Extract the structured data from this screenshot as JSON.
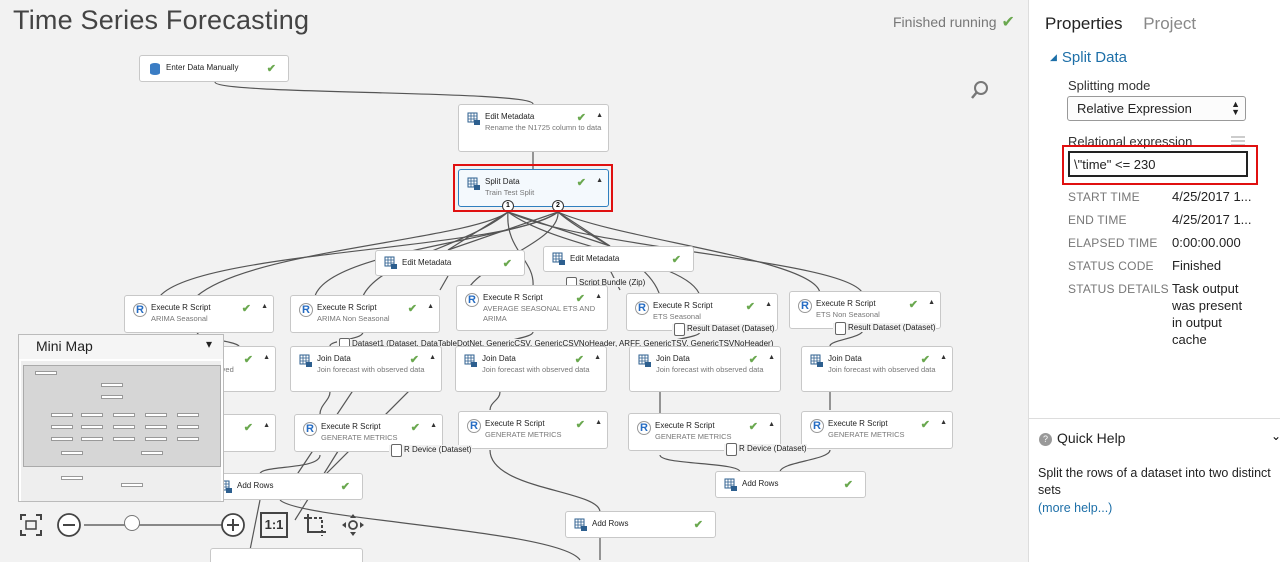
{
  "experiment": {
    "title": "Time Series Forecasting",
    "status": "Finished running",
    "status_icon": "check-icon"
  },
  "nodes": {
    "enter_data": {
      "title": "Enter Data Manually",
      "subtitle": ""
    },
    "edit_meta_1": {
      "title": "Edit Metadata",
      "subtitle": "Rename the N1725 column to data"
    },
    "split": {
      "title": "Split Data",
      "subtitle": "Train Test Split",
      "port1": "1",
      "port2": "2"
    },
    "edit_meta_2": {
      "title": "Edit Metadata",
      "subtitle": ""
    },
    "edit_meta_3": {
      "title": "Edit Metadata",
      "subtitle": ""
    },
    "r_arima": {
      "title": "Execute R Script",
      "subtitle": "ARIMA Seasonal"
    },
    "r_arima_ns": {
      "title": "Execute R Script",
      "subtitle": "ARIMA Non Seasonal"
    },
    "r_avg": {
      "title": "Execute R Script",
      "subtitle": "AVERAGE SEASONAL ETS AND ARIMA"
    },
    "r_ets": {
      "title": "Execute R Script",
      "subtitle": "ETS Seasonal"
    },
    "r_ets_ns": {
      "title": "Execute R Script",
      "subtitle": "ETS Non Seasonal"
    },
    "join_1": {
      "title": "Join Data",
      "subtitle": "Join forecast with observed data"
    },
    "join_2": {
      "title": "Join Data",
      "subtitle": "Join forecast with observed data"
    },
    "join_3": {
      "title": "Join Data",
      "subtitle": "Join forecast with observed data"
    },
    "join_4": {
      "title": "Join Data",
      "subtitle": "Join forecast with observed data"
    },
    "join_0_frag": {
      "title": "",
      "subtitle": "erved"
    },
    "m_1": {
      "title": "Execute R Script",
      "subtitle": "GENERATE METRICS"
    },
    "m_2": {
      "title": "Execute R Script",
      "subtitle": "GENERATE METRICS"
    },
    "m_3": {
      "title": "Execute R Script",
      "subtitle": "GENERATE METRICS"
    },
    "m_4": {
      "title": "Execute R Script",
      "subtitle": "GENERATE METRICS"
    },
    "add_1": {
      "title": "Add Rows"
    },
    "add_2": {
      "title": "Add Rows"
    },
    "add_3": {
      "title": "Add Rows"
    }
  },
  "port_labels": {
    "script_bundle": "Script Bundle (Zip)",
    "result_1": "Result Dataset (Dataset)",
    "result_2": "Result Dataset (Dataset)",
    "dataset1": "Dataset1 (Dataset, DataTableDotNet, GenericCSV, GenericCSVNoHeader, ARFF, GenericTSV, GenericTSVNoHeader)",
    "device_1": "R Device (Dataset)",
    "device_2": "R Device (Dataset)"
  },
  "minimap": {
    "title": "Mini Map",
    "collapse_icon": "chevron-down-icon"
  },
  "zoom": {
    "fit_label": "1:1",
    "level": 0.4
  },
  "properties": {
    "tab_properties": "Properties",
    "tab_project": "Project",
    "module": "Split Data",
    "splitting_mode_label": "Splitting mode",
    "splitting_mode_value": "Relative Expression",
    "relational_label": "Relational expression",
    "relational_value": "\\\"time\" <= 230",
    "rows": [
      {
        "key": "START TIME",
        "value": "4/25/2017 1..."
      },
      {
        "key": "END TIME",
        "value": "4/25/2017 1..."
      },
      {
        "key": "ELAPSED TIME",
        "value": "0:00:00.000"
      },
      {
        "key": "STATUS CODE",
        "value": "Finished"
      },
      {
        "key": "STATUS DETAILS",
        "value": "Task output was present in output cache"
      }
    ]
  },
  "quick_help": {
    "title": "Quick Help",
    "text": "Split the rows of a dataset into two distinct sets",
    "link": "(more help...)"
  },
  "colors": {
    "accent": "#1d6fa8",
    "check": "#6aa84f",
    "highlight": "#e01010"
  }
}
